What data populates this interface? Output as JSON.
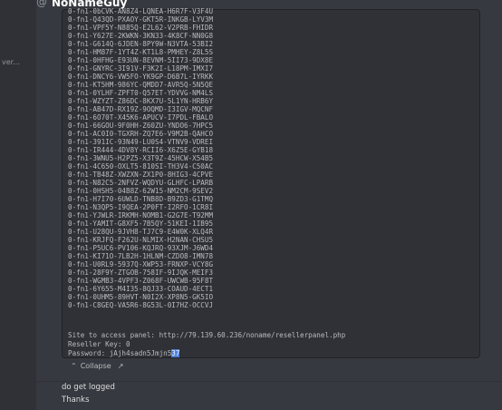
{
  "sidebar": {
    "snippet": "ver..."
  },
  "header": {
    "at_icon": "at-icon",
    "username": "NoNameGuy"
  },
  "code": {
    "lines": [
      "0-fn1-Q43QD-PXAOY-GKT5R-INKGB-LYV3M",
      "0-fn1-VPF5Y-N885Q-E2L62-V2PRB-FHIDR",
      "0-fn1-Y627E-2KWKN-3KN33-4K8CF-NN0G8",
      "0-fn1-G614Q-6JDEN-8PY9W-N3VTA-53BI2",
      "0-fn1-HM87F-1YT4Z-KT1L8-PMHEY-Z8L5S",
      "0-fn1-0HFHG-E93UN-8EVNM-5II73-9DX8E",
      "0-fn1-GNYRC-3I91V-F3K2I-L18PM-IMXI7",
      "0-fn1-DNCY6-VW5FO-YK9GP-D6B7L-IYRKK",
      "0-fn1-KT5HM-986YC-QMDD7-AVR5Q-5N5QE",
      "0-fn1-0YLHF-ZPFT0-Q57ET-YDVVG-NM4LS",
      "0-fn1-WZYZT-Z86DC-8KX7U-5L1YN-HRB6Y",
      "0-fn1-AB47D-RX19Z-9OQMD-I3IGV-MQCNF",
      "0-fn1-6O70T-X45K6-APUCV-I7PDL-FBALO",
      "0-fn1-66GOU-9F0HH-Z60ZU-YNDO6-7HPC5",
      "0-fn1-AC0I0-TGXRH-ZQ7E6-V9M2B-QAHCO",
      "0-fn1-391IC-93N49-LU0S4-VTNV9-VDREI",
      "0-fn1-IR444-4DV8Y-RCII6-X6Z5E-GYB18",
      "0-fn1-3WNU5-H2PZ5-X3T9Z-45HCW-X54B5",
      "0-fn1-4C650-OXLT5-810SI-TH3V4-C50AC",
      "0-fn1-TB48Z-XWZXN-ZX1P0-8HIG3-4CPVE",
      "0-fn1-N82C5-2NFVZ-WQDYU-GLHFC-LPARB",
      "0-fn1-0HSH5-04B8Z-62W15-NM2CM-9SEV2",
      "0-fn1-H7I70-6UWLD-TNB8D-B9ZD3-G1TMQ",
      "0-fn1-N3QP5-I9QEA-2P0FT-I2RFO-1CR8I",
      "0-fn1-YJWLR-IRKMH-NOMB1-G2G7E-T92MM",
      "0-fn1-YAMIT-G8XF5-7B5QY-51KEI-1IB95",
      "0-fn1-U28QU-9JVH8-TJ7C9-E4W0K-XLQ4R",
      "0-fn1-KRJFQ-F262U-NLMIX-H2NAN-CHSU5",
      "0-fn1-P5UC6-PV106-KQJRQ-93XJM-J6WD4",
      "0-fn1-KI71O-7LB2H-1HLNM-CZDO8-IMN78",
      "0-fn1-U0RL9-5937Q-XWP53-FRNXP-VCY8G",
      "0-fn1-28F9Y-ZTGOB-758IF-9IJQK-MEIF3",
      "0-fn1-WGMB3-4VPF3-Z068F-UWCWB-95F8T",
      "0-fn1-6Y655-M4I35-8QJ33-COAUD-4ECT1",
      "0-fn1-0UHM5-89HVT-N0I2X-XP8N5-GK5IO",
      "0-fn1-C8GEQ-VA5R6-8G53L-0I7HZ-OCCVJ"
    ],
    "partial_top_line": "0-fn1-0bCVK-AN8Z4-LQNEA-H6R7F-V3F4U",
    "site_line": "Site to access panel: http://79.139.60.236/noname/resellerpanel.php",
    "reseller_line": "Reseller Key: 0",
    "password_prefix": "Password: jAjh4sadn5Jmjn5",
    "password_selected": "37"
  },
  "collapse_label": "Collapse",
  "messages": [
    "do get logged",
    "Thanks"
  ],
  "colors": {
    "background": "#36393f",
    "codeblock": "#2f3136",
    "selection": "#4f7fd9"
  }
}
